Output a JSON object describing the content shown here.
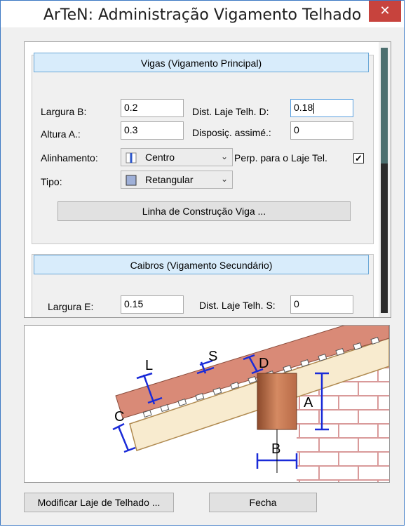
{
  "window": {
    "title": "ArTeN: Administração Vigamento Telhado",
    "close_glyph": "✕"
  },
  "vigas": {
    "header": "Vigas (Vigamento Principal)",
    "largura_b_label": "Largura B:",
    "largura_b_value": "0.2",
    "dist_laje_d_label": "Dist. Laje Telh. D:",
    "dist_laje_d_value": "0.18",
    "altura_a_label": "Altura A.:",
    "altura_a_value": "0.3",
    "disposic_label": "Disposiç. assimé.:",
    "disposic_value": "0",
    "alinhamento_label": "Alinhamento:",
    "alinhamento_value": "Centro",
    "perp_label": "Perp. para o Laje Tel.",
    "perp_checked": true,
    "tipo_label": "Tipo:",
    "tipo_value": "Retangular",
    "linha_button": "Linha de Construção Viga ..."
  },
  "caibros": {
    "header": "Caibros (Vigamento Secundário)",
    "largura_e_label": "Largura E:",
    "largura_e_value": "0.15",
    "dist_laje_s_label": "Dist. Laje Telh. S:",
    "dist_laje_s_value": "0"
  },
  "diagram": {
    "labels": {
      "L": "L",
      "S": "S",
      "D": "D",
      "A": "A",
      "B": "B",
      "C": "C"
    },
    "colors": {
      "roof": "#d98a77",
      "rafter": "#f5e6c8",
      "beam": "#b86a47",
      "brick": "#d9a0a0",
      "dimension": "#1a2bd8"
    }
  },
  "footer": {
    "modify_button": "Modificar Laje de Telhado ...",
    "close_button": "Fecha"
  },
  "icons": [
    "close-icon",
    "center-align-icon",
    "rectangle-icon",
    "chevron-down-icon",
    "checkmark-icon"
  ]
}
